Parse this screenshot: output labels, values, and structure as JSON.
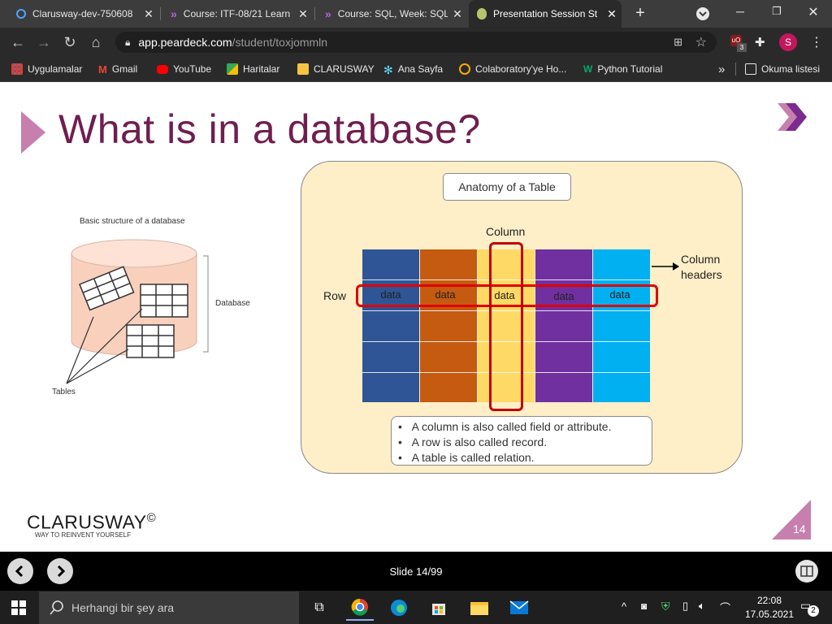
{
  "browser": {
    "tabs": [
      {
        "title": "Clarusway-dev-750608",
        "close": "✕"
      },
      {
        "title": "Course: ITF-08/21 Learn",
        "close": "✕"
      },
      {
        "title": "Course: SQL, Week: SQL",
        "close": "✕"
      },
      {
        "title": "Presentation Session St",
        "close": "✕",
        "active": true
      }
    ],
    "new_tab": "+",
    "url_domain": "app.peardeck.com",
    "url_path": "/student/toxjommln",
    "ublock_count": "3",
    "ublock_label": "uO",
    "profile_initial": "S",
    "bookmarks": [
      "Uygulamalar",
      "Gmail",
      "YouTube",
      "Haritalar",
      "CLARUSWAY",
      "Ana Sayfa",
      "Colaboratory'ye Ho...",
      "Python Tutorial"
    ],
    "more_bookmarks": "»",
    "reading_list": "Okuma listesi"
  },
  "slide": {
    "title": "What is in a database?",
    "left_figure": {
      "caption": "Basic structure of a database",
      "database_label": "Database",
      "tables_label": "Tables"
    },
    "anatomy": {
      "heading": "Anatomy of a Table",
      "column_label": "Column",
      "row_label": "Row",
      "column_headers_label": "Column headers",
      "cell": "data",
      "column_colors": [
        "#2f5597",
        "#c55a11",
        "#ffd966",
        "#7030a0",
        "#00b0f0"
      ],
      "bullets": [
        "A column is also called field or attribute.",
        "A row is also called record.",
        "A table is called relation."
      ]
    },
    "brand": "CLARUSWAY",
    "brand_mark": "©",
    "tagline": "WAY TO REINVENT YOURSELF",
    "page_number": "14",
    "counter": "Slide 14/99"
  },
  "taskbar": {
    "search_placeholder": "Herhangi bir şey ara",
    "time": "22:08",
    "date": "17.05.2021",
    "notif_count": "2"
  }
}
